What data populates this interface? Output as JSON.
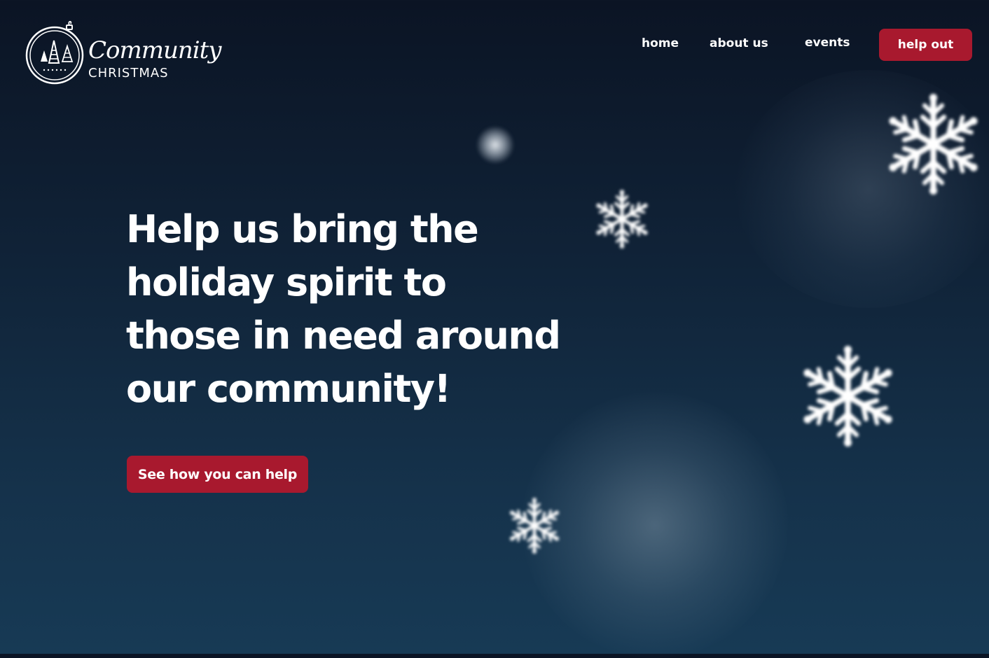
{
  "logo": {
    "script_text": "Community",
    "caps_text": "CHRISTMAS"
  },
  "nav": {
    "items": [
      {
        "label": "home"
      },
      {
        "label": "about us"
      },
      {
        "label": "events"
      }
    ],
    "cta_label": "help out"
  },
  "hero": {
    "title": "Help us bring the holiday spirit to those in need around our community!",
    "cta_label": "See how you can help"
  },
  "icons": {
    "logo": "ornament-with-trees-icon",
    "decor": "snowflake-icon"
  },
  "colors": {
    "accent": "#a8192e",
    "background_top": "#0b1424",
    "background_bottom": "#173a55",
    "text": "#ffffff"
  }
}
